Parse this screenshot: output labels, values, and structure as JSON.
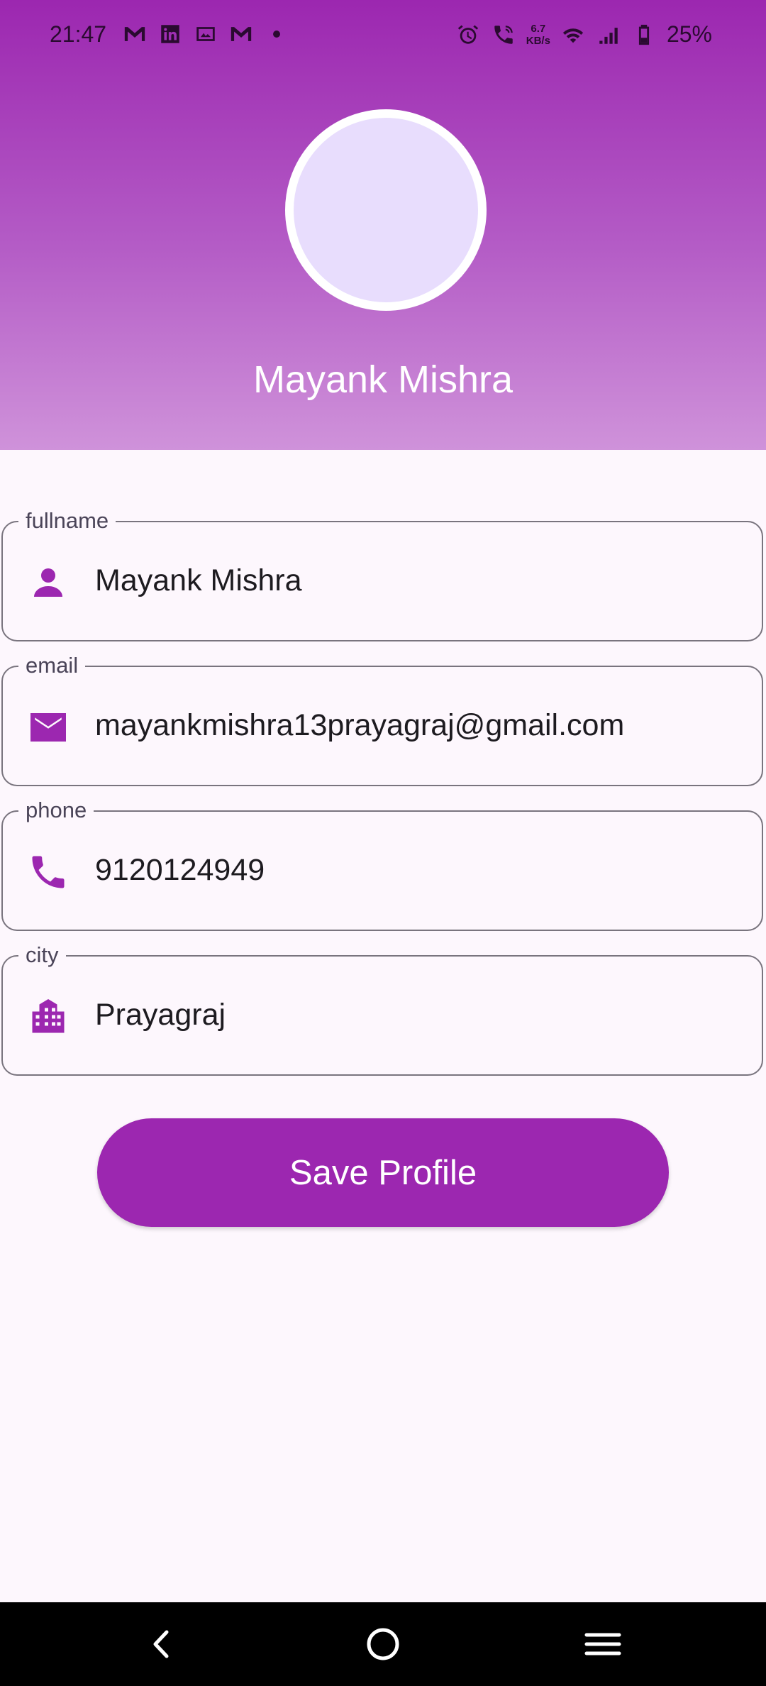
{
  "status_bar": {
    "time": "21:47",
    "notification_icons": [
      "gmail-icon",
      "linkedin-icon",
      "gallery-icon",
      "gmail-icon",
      "dot-icon"
    ],
    "speed_value": "6.7",
    "speed_unit": "KB/s",
    "battery": "25%"
  },
  "profile": {
    "name": "Mayank Mishra"
  },
  "form": {
    "fullname": {
      "label": "fullname",
      "value": "Mayank Mishra",
      "icon": "person-icon"
    },
    "email": {
      "label": "email",
      "value": "mayankmishra13prayagraj@gmail.com",
      "icon": "mail-icon"
    },
    "phone": {
      "label": "phone",
      "value": "9120124949",
      "icon": "phone-icon"
    },
    "city": {
      "label": "city",
      "value": "Prayagraj",
      "icon": "city-icon"
    }
  },
  "actions": {
    "save_label": "Save Profile"
  },
  "colors": {
    "accent": "#9c27b0",
    "avatar_fill": "#e8ddfd",
    "background": "#fdf7fd"
  },
  "navigation": [
    "back-icon",
    "home-icon",
    "menu-icon"
  ]
}
